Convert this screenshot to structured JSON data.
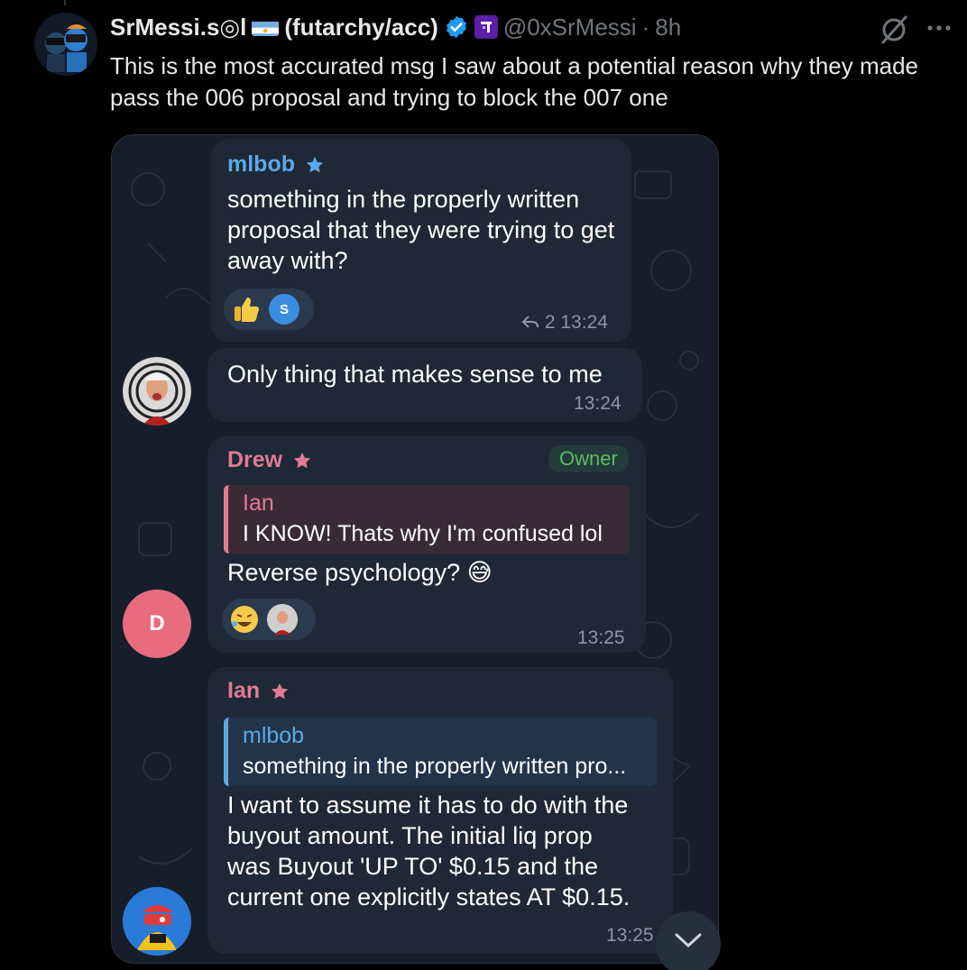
{
  "tweet": {
    "display_name": "SrMessi.s◎l",
    "display_suffix": "(futarchy/acc)",
    "handle": "@0xSrMessi",
    "separator": "·",
    "time": "8h",
    "text": "This is the most accurated msg I saw about a potential reason why they made pass the 006 proposal and trying to block the 007 one",
    "icons": [
      "avatar",
      "argentina-flag-icon",
      "verified-badge-icon",
      "affiliate-badge-icon",
      "grok-icon",
      "more-icon"
    ],
    "accent_color": "#1d9bf0"
  },
  "chat": {
    "messages": [
      {
        "sender": "mlbob",
        "sender_color": "#5aa9e6",
        "text": "something in the properly written proposal that they were trying to get away with?",
        "reactions": [
          "thumbs-up",
          "S"
        ],
        "reply_count": "2",
        "time": "13:24"
      },
      {
        "text": "Only thing that makes sense to me",
        "time": "13:24"
      },
      {
        "sender": "Drew",
        "sender_color": "#e27a93",
        "badge": "Owner",
        "quote_name": "Ian",
        "quote_text": "I KNOW! Thats why I'm confused lol",
        "text": "Reverse psychology? 😅",
        "reactions": [
          "rolling-laughing",
          "avatar"
        ],
        "avatar_letter": "D",
        "time": "13:25"
      },
      {
        "sender": "Ian",
        "sender_color": "#e27a93",
        "quote_name": "mlbob",
        "quote_text": "something in the properly written pro...",
        "text": "I want to assume it has to do with the buyout amount. The initial liq prop was Buyout 'UP TO' $0.15 and the current one explicitly states AT $0.15.",
        "time": "13:25"
      }
    ]
  }
}
